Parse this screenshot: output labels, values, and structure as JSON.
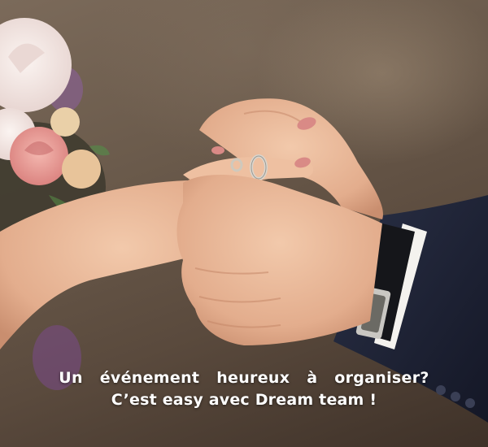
{
  "photo": {
    "subject": "wedding-ring-exchange",
    "colors": {
      "background": "#6a5a4b",
      "skin": "#e9b99a",
      "suit": "#1e2233",
      "cuff": "#f4f2ee",
      "rose": "#e79a95",
      "nail": "#d98a86"
    }
  },
  "caption": {
    "line1": "Un événement heureux à organiser?",
    "line2": "C’est easy avec Dream team !"
  }
}
